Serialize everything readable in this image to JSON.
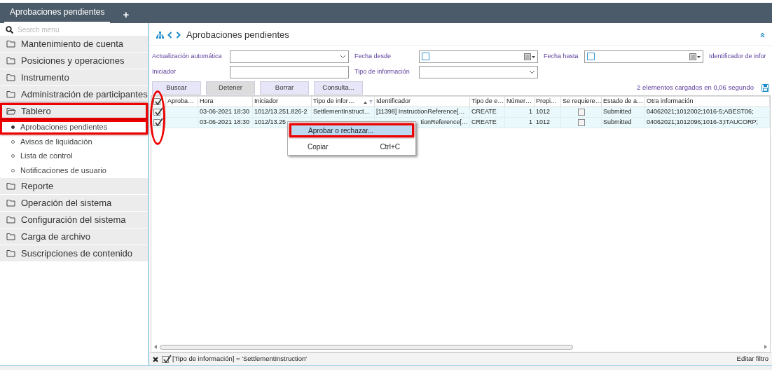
{
  "tabs": [
    {
      "label": "Aprobaciones pendientes",
      "selected": true
    }
  ],
  "add_tab": "+",
  "sidebar": {
    "search": {
      "placeholder": "Search menu"
    },
    "items": [
      {
        "kind": "folder",
        "label": "Mantenimiento de cuenta",
        "expanded": false,
        "highlighted": false
      },
      {
        "kind": "folder",
        "label": "Posiciones y operaciones",
        "expanded": false,
        "highlighted": false
      },
      {
        "kind": "folder",
        "label": "Instrumento",
        "expanded": false,
        "highlighted": false
      },
      {
        "kind": "folder",
        "label": "Administración de participantes",
        "expanded": false,
        "highlighted": false
      },
      {
        "kind": "folder",
        "label": "Tablero",
        "expanded": true,
        "highlighted": true,
        "children": [
          {
            "label": "Aprobaciones pendientes",
            "selected": true,
            "highlighted": true
          },
          {
            "label": "Avisos de liquidación",
            "selected": false,
            "highlighted": false
          },
          {
            "label": "Lista de control",
            "selected": false,
            "highlighted": false
          },
          {
            "label": "Notificaciones de usuario",
            "selected": false,
            "highlighted": false
          }
        ]
      },
      {
        "kind": "folder",
        "label": "Reporte",
        "expanded": false,
        "highlighted": false
      },
      {
        "kind": "folder",
        "label": "Operación del sistema",
        "expanded": false,
        "highlighted": false
      },
      {
        "kind": "folder",
        "label": "Configuración del sistema",
        "expanded": false,
        "highlighted": false
      },
      {
        "kind": "folder",
        "label": "Carga de archivo",
        "expanded": false,
        "highlighted": false
      },
      {
        "kind": "folder",
        "label": "Suscripciones de contenido",
        "expanded": false,
        "highlighted": false
      }
    ]
  },
  "page": {
    "title": "Aprobaciones pendientes"
  },
  "filters": [
    [
      {
        "kind": "select",
        "label": "Actualización automática"
      },
      {
        "kind": "date",
        "label": "Fecha desde"
      },
      {
        "kind": "date",
        "label": "Fecha hasta"
      },
      {
        "kind": "label",
        "label": "Identificador de infor"
      }
    ],
    [
      {
        "kind": "text",
        "label": "Iniciador"
      },
      {
        "kind": "select",
        "label": "Tipo de información"
      }
    ]
  ],
  "buttons": [
    {
      "label": "Buscar",
      "disabled": false
    },
    {
      "label": "Detener",
      "disabled": true
    },
    {
      "label": "Borrar",
      "disabled": false
    },
    {
      "label": "Consulta...",
      "disabled": false
    }
  ],
  "status": "2 elementos cargados en 0,06 segundo",
  "grid": {
    "all_checked": true,
    "checkbox_column_circled": true,
    "columns": [
      {
        "label": "Aproba…",
        "sorted": false
      },
      {
        "label": "Hora",
        "sorted": false
      },
      {
        "label": "Iniciador",
        "sorted": false
      },
      {
        "label": "Tipo de infor…",
        "sorted": true
      },
      {
        "label": "Identificador",
        "sorted": false
      },
      {
        "label": "Tipo de e…",
        "sorted": false
      },
      {
        "label": "Númer…",
        "sorted": false
      },
      {
        "label": "Propi…",
        "sorted": false
      },
      {
        "label": "Se requiere…",
        "sorted": false
      },
      {
        "label": "Estado de a…",
        "sorted": false
      },
      {
        "label": "Otra información",
        "sorted": false
      }
    ],
    "rows": [
      {
        "checked": true,
        "cells": [
          "",
          "03-06-2021 18:30",
          "1012/13.251.826-2",
          "SettlementInstruct…",
          "[11398] InstructionReference[…",
          "CREATE",
          "1",
          "1012",
          false,
          "Submitted",
          "04062021;1012002;1016-5;ABEST06;"
        ]
      },
      {
        "checked": true,
        "cells": [
          "",
          "03-06-2021 18:30",
          "1012/13.25",
          "",
          "tionReference[…",
          "CREATE",
          "1",
          "1012",
          false,
          "Submitted",
          "04062021;1012096;1016-3;ITAUCORP;"
        ]
      }
    ]
  },
  "context_menu": {
    "items": [
      {
        "label": "Aprobar o rechazar...",
        "selected": true,
        "highlighted": true
      },
      {
        "label": "Copiar",
        "shortcut": "Ctrl+C",
        "selected": false,
        "highlighted": false
      }
    ]
  },
  "filter_bar": {
    "enabled": true,
    "expression": "[Tipo de información] = 'SettlementInstruction'",
    "edit": "Editar filtro"
  }
}
